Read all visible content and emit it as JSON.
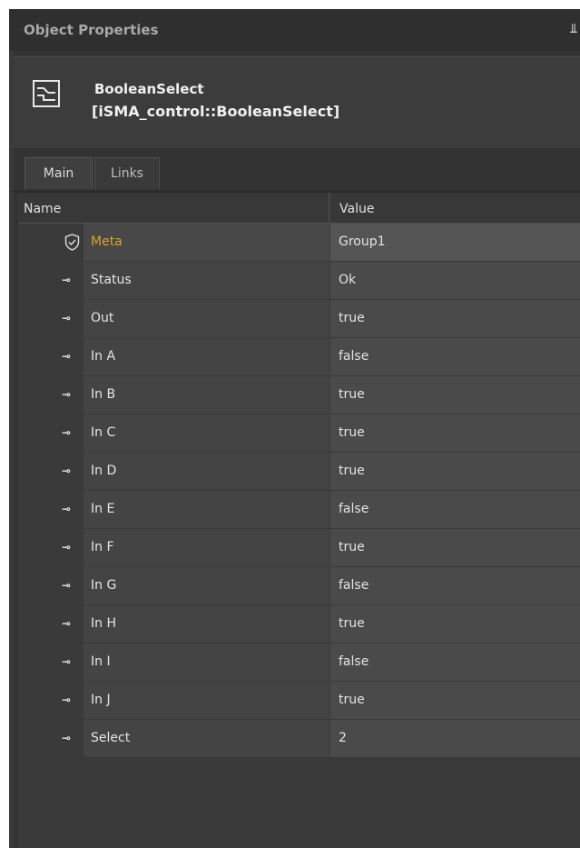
{
  "panel": {
    "title": "Object Properties",
    "pin_icon": "pin-icon"
  },
  "component": {
    "icon": "component-icon",
    "name": "BooleanSelect",
    "type": "[iSMA_control::BooleanSelect]"
  },
  "tabs": [
    {
      "label": "Main",
      "active": true
    },
    {
      "label": "Links",
      "active": false
    }
  ],
  "table": {
    "headers": {
      "name": "Name",
      "value": "Value"
    },
    "rows": [
      {
        "icon": "shield-icon",
        "name": "Meta",
        "value": "Group1"
      },
      {
        "icon": "slot-icon",
        "name": "Status",
        "value": "Ok"
      },
      {
        "icon": "slot-icon",
        "name": "Out",
        "value": "true"
      },
      {
        "icon": "slot-icon",
        "name": "In A",
        "value": "false"
      },
      {
        "icon": "slot-icon",
        "name": "In B",
        "value": "true"
      },
      {
        "icon": "slot-icon",
        "name": "In C",
        "value": "true"
      },
      {
        "icon": "slot-icon",
        "name": "In D",
        "value": "true"
      },
      {
        "icon": "slot-icon",
        "name": "In E",
        "value": "false"
      },
      {
        "icon": "slot-icon",
        "name": "In F",
        "value": "true"
      },
      {
        "icon": "slot-icon",
        "name": "In G",
        "value": "false"
      },
      {
        "icon": "slot-icon",
        "name": "In H",
        "value": "true"
      },
      {
        "icon": "slot-icon",
        "name": "In I",
        "value": "false"
      },
      {
        "icon": "slot-icon",
        "name": "In J",
        "value": "true"
      },
      {
        "icon": "slot-icon",
        "name": "Select",
        "value": "2"
      }
    ]
  },
  "colors": {
    "meta_highlight": "#e6a020",
    "background": "#3a3a3a"
  }
}
